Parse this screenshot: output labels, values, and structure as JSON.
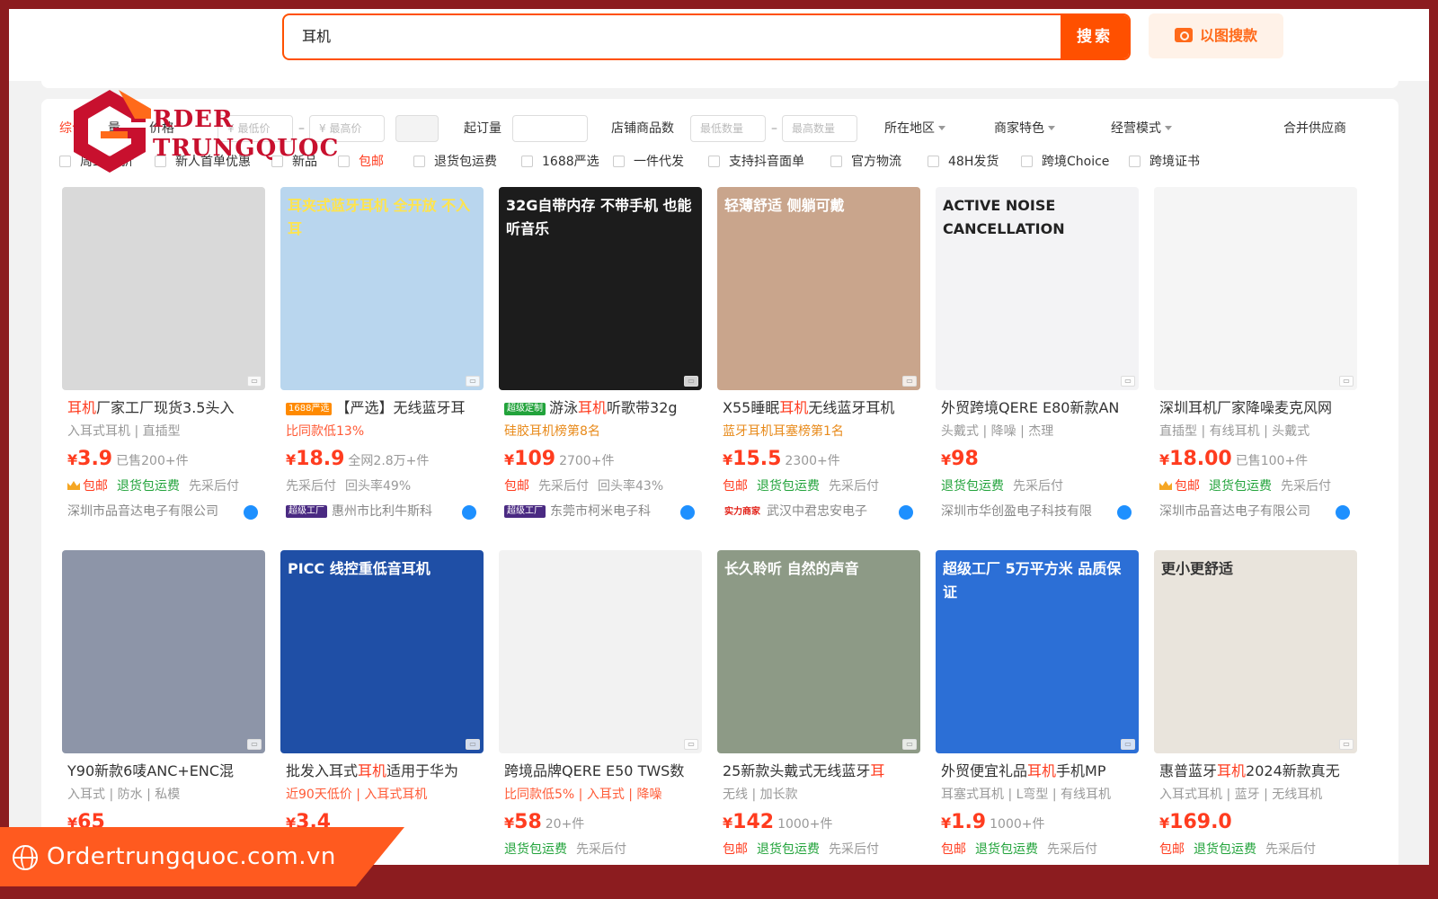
{
  "search": {
    "query": "耳机",
    "button": "搜索",
    "image_search": "以图搜款"
  },
  "filters": {
    "row1": {
      "sort_hidden": "综合",
      "sort_sales": "量",
      "sort_price": "价格",
      "min_price_placeholder": "¥ 最低价",
      "max_price_placeholder": "¥ 最高价",
      "min_order_label": "起订量",
      "store_count_label": "店铺商品数",
      "min_qty_placeholder": "最低数量",
      "max_qty_placeholder": "最高数量",
      "region": "所在地区",
      "merchant": "商家特色",
      "mode": "经营模式",
      "merge": "合并供应商",
      "dash": "–"
    },
    "row2": [
      "周三88折",
      "新人首单优惠",
      "新品",
      "包邮",
      "退货包运费",
      "1688严选",
      "一件代发",
      "支持抖音面单",
      "官方物流",
      "48H发货",
      "跨境Choice",
      "跨境证书"
    ]
  },
  "logo": {
    "line1": "RDER",
    "line2": "TRUNGQUOC"
  },
  "products": [
    {
      "caption": "",
      "title_hl": "耳机",
      "title_rest": "厂家工厂现货3.5头入",
      "badge": "",
      "sub": "入耳式耳机 | 直插型",
      "sub_style": "",
      "price_cur": "¥",
      "price": "3.9",
      "sold": "已售200+件",
      "svc": [
        "包邮",
        "退货包运费",
        "先采后付"
      ],
      "crown": true,
      "shop_badge": "",
      "shop": "深圳市品音达电子有限公司",
      "bg": "#d9d9d9"
    },
    {
      "caption": "耳夹式蓝牙耳机 全开放 不入耳",
      "title_hl": "",
      "title_rest": "【严选】无线蓝牙耳",
      "badge": "1688严选",
      "sub": "比同款低13%",
      "sub_style": "red",
      "price_cur": "¥",
      "price": "18.9",
      "sold": "全网2.8万+件",
      "svc": [
        "先采后付",
        "回头率49%"
      ],
      "crown": false,
      "shop_badge": "超级工厂",
      "shop": "惠州市比利牛斯科",
      "bg": "#b9d6ee"
    },
    {
      "caption": "32G自带内存 不带手机 也能听音乐",
      "title_hl": "耳机",
      "title_rest": "听歌带32g",
      "title_pre": "游泳",
      "badge": "超级定制",
      "sub": "硅胶耳机榜第8名",
      "sub_style": "org",
      "price_cur": "¥",
      "price": "109",
      "sold": "2700+件",
      "svc": [
        "包邮",
        "先采后付",
        "回头率43%"
      ],
      "crown": false,
      "shop_badge": "超级工厂",
      "shop": "东莞市柯米电子科",
      "bg": "#1c1c1c"
    },
    {
      "caption": "轻薄舒适 侧躺可戴",
      "title_hl": "耳机",
      "title_rest": "无线蓝牙耳机",
      "title_pre": "X55睡眠",
      "badge": "",
      "sub": "蓝牙耳机耳塞榜第1名",
      "sub_style": "org",
      "price_cur": "¥",
      "price": "15.5",
      "sold": "2300+件",
      "svc": [
        "包邮",
        "退货包运费",
        "先采后付"
      ],
      "crown": false,
      "shop_badge": "实力商家",
      "shop": "武汉中君忠安电子",
      "bg": "#c9a58c"
    },
    {
      "caption": "ACTIVE NOISE CANCELLATION",
      "title_hl": "",
      "title_rest": "外贸跨境QERE E80新款AN",
      "badge": "",
      "sub": "头戴式 | 降噪 | 杰理",
      "sub_style": "",
      "price_cur": "¥",
      "price": "98",
      "sold": "",
      "svc": [
        "退货包运费",
        "先采后付"
      ],
      "crown": false,
      "shop_badge": "",
      "shop": "深圳市华创盈电子科技有限",
      "bg": "#f3f3f5"
    },
    {
      "caption": "",
      "title_hl": "",
      "title_rest": "深圳耳机厂家降噪麦克风网",
      "badge": "",
      "sub": "直插型 | 有线耳机 | 头戴式",
      "sub_style": "",
      "price_cur": "¥",
      "price": "18.00",
      "sold": "已售100+件",
      "svc": [
        "包邮",
        "退货包运费",
        "先采后付"
      ],
      "crown": true,
      "shop_badge": "",
      "shop": "深圳市品音达电子有限公司",
      "bg": "#f5f5f5"
    },
    {
      "caption": "",
      "title_hl": "",
      "title_rest": "Y90新款6唛ANC+ENC混",
      "badge": "",
      "sub": "入耳式 | 防水 | 私模",
      "sub_style": "",
      "price_cur": "¥",
      "price": "65",
      "sold": "",
      "svc": [],
      "crown": false,
      "shop_badge": "",
      "shop": "",
      "bg": "#8d95a8"
    },
    {
      "caption": "PICC 线控重低音耳机",
      "title_hl": "耳机",
      "title_rest": "适用于华为",
      "title_pre": "批发入耳式",
      "badge": "",
      "sub": "近90天低价 | 入耳式耳机",
      "sub_style": "red",
      "price_cur": "¥",
      "price": "3.4",
      "sold": "",
      "svc": [],
      "crown": false,
      "shop_badge": "",
      "shop": "",
      "bg": "#1f4fa6"
    },
    {
      "caption": "",
      "title_hl": "",
      "title_rest": "跨境品牌QERE E50 TWS数",
      "badge": "",
      "sub": "比同款低5% | 入耳式 | 降噪",
      "sub_style": "red",
      "price_cur": "¥",
      "price": "58",
      "sold": "20+件",
      "svc": [
        "退货包运费",
        "先采后付"
      ],
      "crown": false,
      "shop_badge": "",
      "shop": "",
      "bg": "#f2f2f2"
    },
    {
      "caption": "长久聆听 自然的声音",
      "title_hl": "耳",
      "title_rest": "",
      "title_pre": "25新款头戴式无线蓝牙",
      "badge": "",
      "sub": "无线 | 加长款",
      "sub_style": "",
      "price_cur": "¥",
      "price": "142",
      "sold": "1000+件",
      "svc": [
        "包邮",
        "退货包运费",
        "先采后付"
      ],
      "crown": false,
      "shop_badge": "",
      "shop": "",
      "bg": "#8d9a86"
    },
    {
      "caption": "超级工厂 5万平方米 品质保证",
      "title_hl": "耳机",
      "title_rest": "手机MP",
      "title_pre": "外贸便宜礼品",
      "badge": "",
      "sub": "耳塞式耳机 | L弯型 | 有线耳机",
      "sub_style": "",
      "price_cur": "¥",
      "price": "1.9",
      "sold": "1000+件",
      "svc": [
        "包邮",
        "退货包运费",
        "先采后付"
      ],
      "crown": false,
      "shop_badge": "",
      "shop": "",
      "bg": "#2c6fd6"
    },
    {
      "caption": "更小更舒适",
      "title_hl": "耳机",
      "title_rest": "2024新款真无",
      "title_pre": "惠普蓝牙",
      "badge": "",
      "sub": "入耳式耳机 | 蓝牙 | 无线耳机",
      "sub_style": "",
      "price_cur": "¥",
      "price": "169.0",
      "sold": "",
      "svc": [
        "包邮",
        "退货包运费",
        "先采后付"
      ],
      "crown": false,
      "shop_badge": "",
      "shop": "",
      "bg": "#e9e4dc"
    }
  ],
  "banner": {
    "site": "Ordertrungquoc.com.vn"
  }
}
